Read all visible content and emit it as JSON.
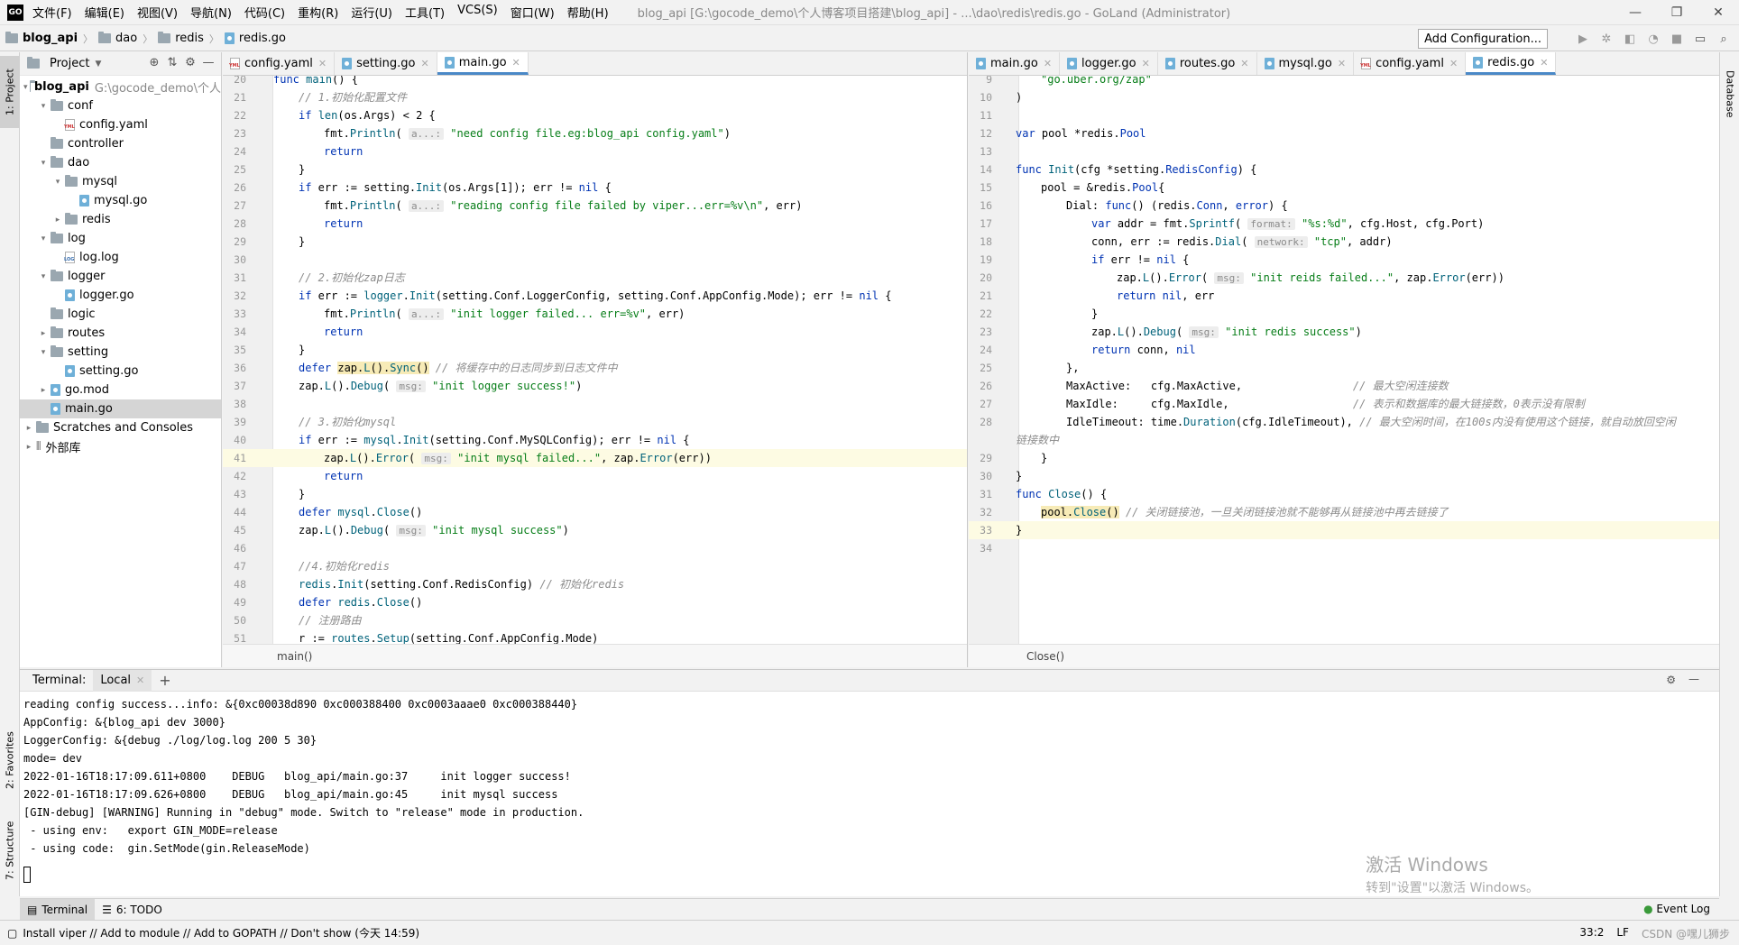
{
  "app": {
    "logo": "GO",
    "menu": [
      "文件(F)",
      "编辑(E)",
      "视图(V)",
      "导航(N)",
      "代码(C)",
      "重构(R)",
      "运行(U)",
      "工具(T)",
      "VCS(S)",
      "窗口(W)",
      "帮助(H)"
    ],
    "window_title": "blog_api [G:\\gocode_demo\\个人博客项目搭建\\blog_api] - ...\\dao\\redis\\redis.go - GoLand (Administrator)"
  },
  "navbar": {
    "crumbs": [
      "blog_api",
      "dao",
      "redis",
      "redis.go"
    ],
    "add_config": "Add Configuration..."
  },
  "strips": {
    "project": "1: Project",
    "favorites": "2: Favorites",
    "structure": "7: Structure",
    "database": "Database"
  },
  "project": {
    "title": "Project",
    "tree": [
      {
        "label": "blog_api",
        "path": "G:\\gocode_demo\\个人",
        "indent": 0,
        "arrow": "▾",
        "icon": "folder",
        "bold": true
      },
      {
        "label": "conf",
        "indent": 1,
        "arrow": "▾",
        "icon": "folder"
      },
      {
        "label": "config.yaml",
        "indent": 2,
        "arrow": "",
        "icon": "yml"
      },
      {
        "label": "controller",
        "indent": 1,
        "arrow": "",
        "icon": "folder"
      },
      {
        "label": "dao",
        "indent": 1,
        "arrow": "▾",
        "icon": "folder"
      },
      {
        "label": "mysql",
        "indent": 2,
        "arrow": "▾",
        "icon": "folder"
      },
      {
        "label": "mysql.go",
        "indent": 3,
        "arrow": "",
        "icon": "go"
      },
      {
        "label": "redis",
        "indent": 2,
        "arrow": "▸",
        "icon": "folder"
      },
      {
        "label": "log",
        "indent": 1,
        "arrow": "▾",
        "icon": "folder"
      },
      {
        "label": "log.log",
        "indent": 2,
        "arrow": "",
        "icon": "log"
      },
      {
        "label": "logger",
        "indent": 1,
        "arrow": "▾",
        "icon": "folder"
      },
      {
        "label": "logger.go",
        "indent": 2,
        "arrow": "",
        "icon": "go"
      },
      {
        "label": "logic",
        "indent": 1,
        "arrow": "",
        "icon": "folder"
      },
      {
        "label": "routes",
        "indent": 1,
        "arrow": "▸",
        "icon": "folder"
      },
      {
        "label": "setting",
        "indent": 1,
        "arrow": "▾",
        "icon": "folder"
      },
      {
        "label": "setting.go",
        "indent": 2,
        "arrow": "",
        "icon": "go"
      },
      {
        "label": "go.mod",
        "indent": 1,
        "arrow": "▸",
        "icon": "go"
      },
      {
        "label": "main.go",
        "indent": 1,
        "arrow": "",
        "icon": "go",
        "selected": true
      },
      {
        "label": "Scratches and Consoles",
        "indent": 0,
        "arrow": "▸",
        "icon": "folder"
      },
      {
        "label": "外部库",
        "indent": 0,
        "arrow": "▸",
        "icon": "lib"
      }
    ]
  },
  "left_editor": {
    "tabs": [
      {
        "label": "config.yaml",
        "icon": "yml",
        "active": false
      },
      {
        "label": "setting.go",
        "icon": "go",
        "active": false
      },
      {
        "label": "main.go",
        "icon": "go",
        "active": true
      }
    ],
    "breadcrumb": "main()",
    "lines": [
      {
        "n": "20",
        "indent": 0,
        "html": "<span class='kw'>func</span> <span class='fn'>main</span>() {"
      },
      {
        "n": "21",
        "indent": 1,
        "html": "<span class='cm'>// 1.初始化配置文件</span>"
      },
      {
        "n": "22",
        "indent": 1,
        "html": "<span class='kw'>if</span> <span class='fn'>len</span>(os.Args) &lt; 2 {"
      },
      {
        "n": "23",
        "indent": 2,
        "html": "fmt.<span class='fn'>Println</span>( <span class='hint'>a...:</span> <span class='st'>\"need config file.eg:blog_api config.yaml\"</span>)"
      },
      {
        "n": "24",
        "indent": 2,
        "html": "<span class='kw'>return</span>"
      },
      {
        "n": "25",
        "indent": 1,
        "html": "}"
      },
      {
        "n": "26",
        "indent": 1,
        "html": "<span class='kw'>if</span> err := setting.<span class='fn'>Init</span>(os.Args[1]); err != <span class='kw'>nil</span> {"
      },
      {
        "n": "27",
        "indent": 2,
        "html": "fmt.<span class='fn'>Println</span>( <span class='hint'>a...:</span> <span class='st'>\"reading config file failed by viper...err=%v\\n\"</span>, err)"
      },
      {
        "n": "28",
        "indent": 2,
        "html": "<span class='kw'>return</span>"
      },
      {
        "n": "29",
        "indent": 1,
        "html": "}"
      },
      {
        "n": "30",
        "indent": 0,
        "html": ""
      },
      {
        "n": "31",
        "indent": 1,
        "html": "<span class='cm'>// 2.初始化zap日志</span>"
      },
      {
        "n": "32",
        "indent": 1,
        "html": "<span class='kw'>if</span> err := <span class='fn'>logger</span>.<span class='fn'>Init</span>(setting.Conf.LoggerConfig, setting.Conf.AppConfig.Mode); err != <span class='kw'>nil</span> {"
      },
      {
        "n": "33",
        "indent": 2,
        "html": "fmt.<span class='fn'>Println</span>( <span class='hint'>a...:</span> <span class='st'>\"init logger failed... err=%v\"</span>, err)"
      },
      {
        "n": "34",
        "indent": 2,
        "html": "<span class='kw'>return</span>"
      },
      {
        "n": "35",
        "indent": 1,
        "html": "}"
      },
      {
        "n": "36",
        "indent": 1,
        "html": "<span class='kw'>defer</span> <span class='warn-bg'>zap.<span class='fn'>L</span>().<span class='fn'>Sync</span>()</span> <span class='cm'>// 将缓存中的日志同步到日志文件中</span>"
      },
      {
        "n": "37",
        "indent": 1,
        "html": "zap.<span class='fn'>L</span>().<span class='fn'>Debug</span>( <span class='hint'>msg:</span> <span class='st'>\"init logger success!\"</span>)"
      },
      {
        "n": "38",
        "indent": 0,
        "html": ""
      },
      {
        "n": "39",
        "indent": 1,
        "html": "<span class='cm'>// 3.初始化mysql</span>"
      },
      {
        "n": "40",
        "indent": 1,
        "html": "<span class='kw'>if</span> err := <span class='fn'>mysql</span>.<span class='fn'>Init</span>(setting.Conf.MySQLConfig); err != <span class='kw'>nil</span> {"
      },
      {
        "n": "41",
        "indent": 2,
        "hl": true,
        "html": "zap.<span class='fn'>L</span>().<span class='fn'>Error</span>( <span class='hint'>msg:</span> <span class='st'>\"init mysql failed...\"</span>, zap.<span class='fn'>Error</span>(err))"
      },
      {
        "n": "42",
        "indent": 2,
        "html": "<span class='kw'>return</span>"
      },
      {
        "n": "43",
        "indent": 1,
        "html": "}"
      },
      {
        "n": "44",
        "indent": 1,
        "html": "<span class='kw'>defer</span> <span class='fn'>mysql</span>.<span class='fn'>Close</span>()"
      },
      {
        "n": "45",
        "indent": 1,
        "html": "zap.<span class='fn'>L</span>().<span class='fn'>Debug</span>( <span class='hint'>msg:</span> <span class='st'>\"init mysql success\"</span>)"
      },
      {
        "n": "46",
        "indent": 0,
        "html": ""
      },
      {
        "n": "47",
        "indent": 1,
        "html": "<span class='cm'>//4.初始化redis</span>"
      },
      {
        "n": "48",
        "indent": 1,
        "html": "<span class='fn'>redis</span>.<span class='fn'>Init</span>(setting.Conf.RedisConfig) <span class='cm'>// 初始化redis</span>"
      },
      {
        "n": "49",
        "indent": 1,
        "html": "<span class='kw'>defer</span> <span class='fn'>redis</span>.<span class='fn'>Close</span>()"
      },
      {
        "n": "50",
        "indent": 1,
        "html": "<span class='cm'>// 注册路由</span>"
      },
      {
        "n": "51",
        "indent": 1,
        "html": "r := <span class='fn'>routes</span>.<span class='fn'>Setup</span>(setting.Conf.AppConfig.Mode)"
      }
    ]
  },
  "right_editor": {
    "tabs": [
      {
        "label": "main.go",
        "icon": "go",
        "active": false
      },
      {
        "label": "logger.go",
        "icon": "go",
        "active": false
      },
      {
        "label": "routes.go",
        "icon": "go",
        "active": false
      },
      {
        "label": "mysql.go",
        "icon": "go",
        "active": false
      },
      {
        "label": "config.yaml",
        "icon": "yml",
        "active": false
      },
      {
        "label": "redis.go",
        "icon": "go",
        "active": true
      }
    ],
    "breadcrumb": "Close()",
    "lines": [
      {
        "n": "9",
        "indent": 1,
        "html": "<span class='st'>\"go.uber.org/zap\"</span>"
      },
      {
        "n": "10",
        "indent": 0,
        "html": ")"
      },
      {
        "n": "11",
        "indent": 0,
        "html": ""
      },
      {
        "n": "12",
        "indent": 0,
        "html": "<span class='kw'>var</span> pool *redis.<span class='ty'>Pool</span>"
      },
      {
        "n": "13",
        "indent": 0,
        "html": ""
      },
      {
        "n": "14",
        "indent": 0,
        "html": "<span class='kw'>func</span> <span class='fn'>Init</span>(cfg *setting.<span class='ty'>RedisConfig</span>) {"
      },
      {
        "n": "15",
        "indent": 1,
        "html": "pool = &amp;redis.<span class='ty'>Pool</span>{"
      },
      {
        "n": "16",
        "indent": 2,
        "html": "Dial: <span class='kw'>func</span>() (redis.<span class='ty'>Conn</span>, <span class='ty'>error</span>) {"
      },
      {
        "n": "17",
        "indent": 3,
        "html": "<span class='kw'>var</span> addr = fmt.<span class='fn'>Sprintf</span>( <span class='hint'>format:</span> <span class='st'>\"%s:%d\"</span>, cfg.Host, cfg.Port)"
      },
      {
        "n": "18",
        "indent": 3,
        "html": "conn, err := redis.<span class='fn'>Dial</span>( <span class='hint'>network:</span> <span class='st'>\"tcp\"</span>, addr)"
      },
      {
        "n": "19",
        "indent": 3,
        "html": "<span class='kw'>if</span> err != <span class='kw'>nil</span> {"
      },
      {
        "n": "20",
        "indent": 4,
        "html": "zap.<span class='fn'>L</span>().<span class='fn'>Error</span>( <span class='hint'>msg:</span> <span class='st'>\"init reids failed...\"</span>, zap.<span class='fn'>Error</span>(err))"
      },
      {
        "n": "21",
        "indent": 4,
        "html": "<span class='kw'>return</span> <span class='kw'>nil</span>, err"
      },
      {
        "n": "22",
        "indent": 3,
        "html": "}"
      },
      {
        "n": "23",
        "indent": 3,
        "html": "zap.<span class='fn'>L</span>().<span class='fn'>Debug</span>( <span class='hint'>msg:</span> <span class='st'>\"init redis success\"</span>)"
      },
      {
        "n": "24",
        "indent": 3,
        "html": "<span class='kw'>return</span> conn, <span class='kw'>nil</span>"
      },
      {
        "n": "25",
        "indent": 2,
        "html": "},"
      },
      {
        "n": "26",
        "indent": 2,
        "html": "MaxActive:   cfg.MaxActive,                 <span class='cm'>// 最大空闲连接数</span>"
      },
      {
        "n": "27",
        "indent": 2,
        "html": "MaxIdle:     cfg.MaxIdle,                   <span class='cm'>// 表示和数据库的最大链接数，0表示没有限制</span>"
      },
      {
        "n": "28",
        "indent": 2,
        "html": "IdleTimeout: time.<span class='fn'>Duration</span>(cfg.IdleTimeout), <span class='cm'>// 最大空闲时间，在100s内没有使用这个链接，就自动放回空闲</span>"
      },
      {
        "n": "",
        "indent": 0,
        "html": "<span class='cm'>链接数中</span>"
      },
      {
        "n": "29",
        "indent": 1,
        "html": "}"
      },
      {
        "n": "30",
        "indent": 0,
        "html": "}"
      },
      {
        "n": "31",
        "indent": 0,
        "html": "<span class='kw'>func</span> <span class='fn'>Close</span>() {"
      },
      {
        "n": "32",
        "indent": 1,
        "html": "<span class='warn-bg'>pool.<span class='fn'>Close</span>()</span> <span class='cm'>// 关闭链接池，一旦关闭链接池就不能够再从链接池中再去链接了</span>"
      },
      {
        "n": "33",
        "indent": 0,
        "hl": true,
        "html": "}"
      },
      {
        "n": "34",
        "indent": 0,
        "html": ""
      }
    ]
  },
  "terminal": {
    "title": "Terminal:",
    "tab": "Local",
    "lines": [
      "reading config success...info: &{0xc00038d890 0xc000388400 0xc0003aaae0 0xc000388440}",
      "AppConfig: &{blog_api dev 3000}",
      "LoggerConfig: &{debug ./log/log.log 200 5 30}",
      "mode= dev",
      "2022-01-16T18:17:09.611+0800    DEBUG   blog_api/main.go:37     init logger success!",
      "2022-01-16T18:17:09.626+0800    DEBUG   blog_api/main.go:45     init mysql success",
      "[GIN-debug] [WARNING] Running in \"debug\" mode. Switch to \"release\" mode in production.",
      " - using env:   export GIN_MODE=release",
      " - using code:  gin.SetMode(gin.ReleaseMode)"
    ],
    "watermark_title": "激活 Windows",
    "watermark_sub": "转到\"设置\"以激活 Windows。"
  },
  "bottom_tabs": {
    "terminal": "Terminal",
    "todo": "6: TODO",
    "event_log": "Event Log"
  },
  "status": {
    "message": "Install viper // Add to module // Add to GOPATH // Don't show (今天 14:59)",
    "position": "33:2",
    "line_sep": "LF",
    "overlay": "CSDN @嘿儿狮步"
  }
}
